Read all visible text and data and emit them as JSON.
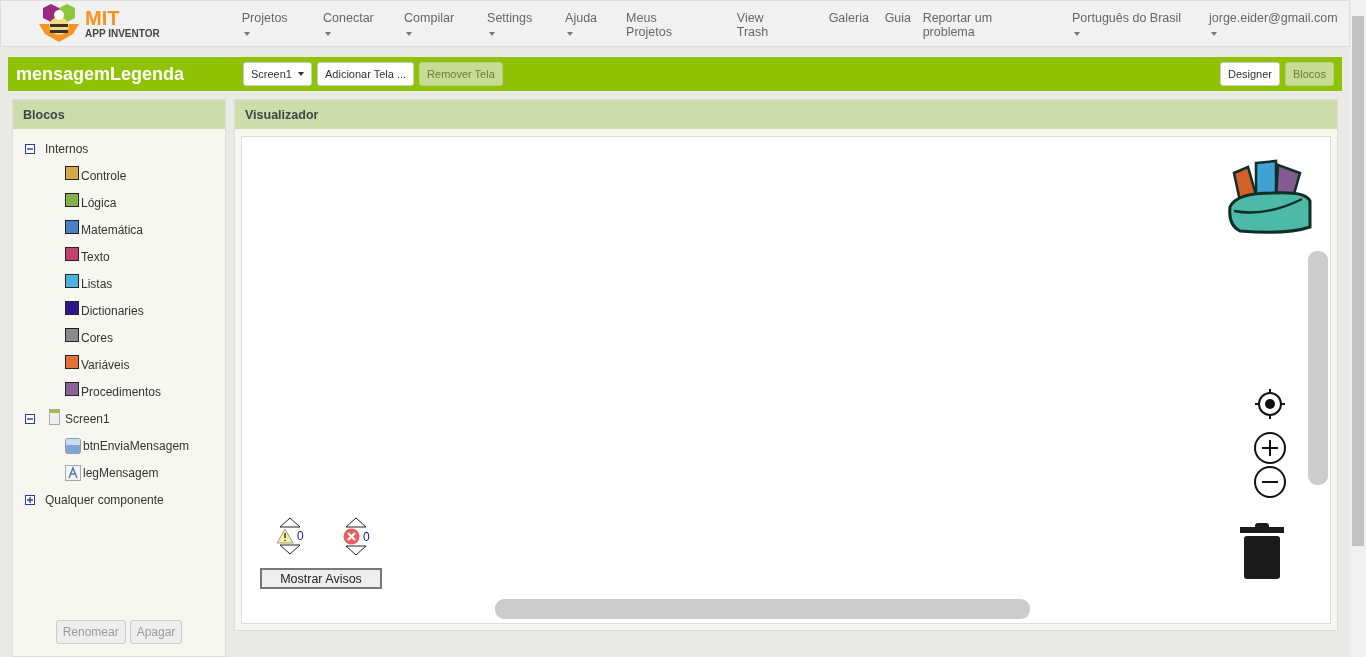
{
  "logo": {
    "name": "MIT",
    "subtitle": "APP INVENTOR"
  },
  "nav": [
    {
      "label": "Projetos",
      "dropdown": true
    },
    {
      "label": "Conectar",
      "dropdown": true
    },
    {
      "label": "Compilar",
      "dropdown": true
    },
    {
      "label": "Settings",
      "dropdown": true
    },
    {
      "label": "Ajuda",
      "dropdown": true
    },
    {
      "label": "Meus Projetos",
      "dropdown": false
    },
    {
      "label": "View Trash",
      "dropdown": false
    },
    {
      "label": "Galeria",
      "dropdown": false
    },
    {
      "label": "Guia",
      "dropdown": false
    },
    {
      "label": "Reportar um problema",
      "dropdown": false
    },
    {
      "label": "Português do Brasil",
      "dropdown": true
    },
    {
      "label": "jorge.eider@gmail.com",
      "dropdown": true
    }
  ],
  "project": {
    "title": "mensagemLegenda",
    "screen": "Screen1",
    "buttons": [
      {
        "label": "Adicionar Tela ...",
        "disabled": false
      },
      {
        "label": "Remover Tela",
        "disabled": true
      }
    ],
    "views": [
      {
        "label": "Designer",
        "selected": false
      },
      {
        "label": "Blocos",
        "selected": true
      }
    ]
  },
  "blocks": {
    "title": "Blocos",
    "tree": [
      {
        "label": "Internos",
        "kind": "group",
        "expanded": true,
        "children": [
          {
            "label": "Controle",
            "kind": "category",
            "color": "#d4a948"
          },
          {
            "label": "Lógica",
            "kind": "category",
            "color": "#83b34f"
          },
          {
            "label": "Matemática",
            "kind": "category",
            "color": "#4a80c0"
          },
          {
            "label": "Texto",
            "kind": "category",
            "color": "#c3406e"
          },
          {
            "label": "Listas",
            "kind": "category",
            "color": "#4db3dd"
          },
          {
            "label": "Dictionaries",
            "kind": "category",
            "color": "#2b168f"
          },
          {
            "label": "Cores",
            "kind": "category",
            "color": "#8a8a8a"
          },
          {
            "label": "Variáveis",
            "kind": "category",
            "color": "#dd7137"
          },
          {
            "label": "Procedimentos",
            "kind": "category",
            "color": "#8c6294"
          }
        ]
      },
      {
        "label": "Screen1",
        "kind": "screen",
        "expanded": true,
        "children": [
          {
            "label": "btnEnviaMensagem",
            "kind": "button"
          },
          {
            "label": "legMensagem",
            "kind": "label"
          }
        ]
      },
      {
        "label": "Qualquer componente",
        "kind": "group",
        "expanded": false
      }
    ],
    "buttons": [
      {
        "label": "Renomear",
        "disabled": true
      },
      {
        "label": "Apagar",
        "disabled": true
      }
    ]
  },
  "viewer": {
    "title": "Visualizador",
    "warnings": "0",
    "errors": "0",
    "toggle_button": "Mostrar Avisos"
  }
}
